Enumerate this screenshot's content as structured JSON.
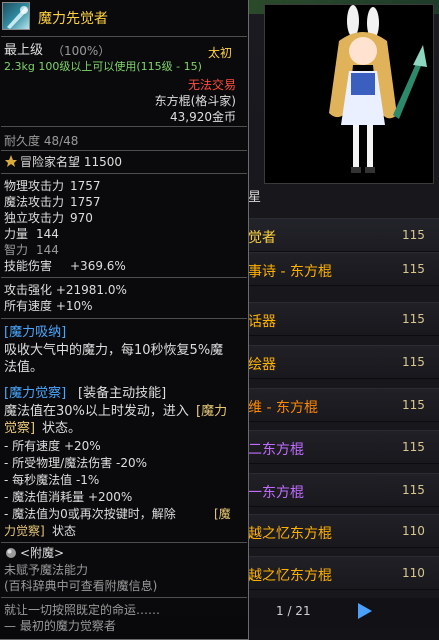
{
  "background": {
    "tab_label": "星",
    "items": [
      {
        "name": "觉者",
        "level": "115",
        "color": "#ffd23e"
      },
      {
        "name": "事诗 - 东方棍",
        "level": "115",
        "color": "#ffb100"
      },
      {
        "name": "话器",
        "level": "115",
        "color": "#ffb100"
      },
      {
        "name": "绘器",
        "level": "115",
        "color": "#ffb100"
      },
      {
        "name": "维 - 东方棍",
        "level": "115",
        "color": "#ff8800"
      },
      {
        "name": "二东方棍",
        "level": "115",
        "color": "#c26cff"
      },
      {
        "name": "一东方棍",
        "level": "115",
        "color": "#c26cff"
      },
      {
        "name": "越之忆东方棍",
        "level": "110",
        "color": "#ffb100"
      },
      {
        "name": "越之忆东方棍",
        "level": "110",
        "color": "#ffb100"
      }
    ],
    "page": "1 / 21"
  },
  "tooltip": {
    "title": "魔力先觉者",
    "grade": "最上级",
    "grade_pct": "（100%）",
    "rarity": "太初",
    "weight_req": "2.3kg  100级以上可以使用(115级 - 15)",
    "trade": "无法交易",
    "weapon_type": "东方棍(格斗家)",
    "price": "43,920金币",
    "durability": "耐久度 48/48",
    "adventurer": "冒险家名望 11500",
    "stats": [
      {
        "label": "物理攻击力",
        "value": "1757",
        "dim": false
      },
      {
        "label": "魔法攻击力",
        "value": "1757",
        "dim": false
      },
      {
        "label": "独立攻击力",
        "value": "970",
        "dim": false
      },
      {
        "label": "力量",
        "value": "144",
        "dim": false
      },
      {
        "label": "智力",
        "value": "144",
        "dim": true
      },
      {
        "label": "技能伤害",
        "value": "+369.6%",
        "dim": false
      }
    ],
    "attack_boost": "攻击强化 +21981.0%",
    "all_speed": "所有速度 +10%",
    "mana_absorb_title": "[魔力吸纳]",
    "mana_absorb_line1": "吸收大气中的魔力，每10秒恢复5%魔",
    "mana_absorb_line2": "法值。",
    "awaken_title": "[魔力觉察]",
    "awaken_tag": "[装备主动技能]",
    "awaken_line1a": "魔法值在30%以上时发动，进入",
    "awaken_line1b": "[魔力",
    "awaken_line2a": "觉察]",
    "awaken_line2b": "状态。",
    "awaken_effects": [
      "- 所有速度 +20%",
      "- 所受物理/魔法伤害 -20%",
      "- 每秒魔法值 -1%",
      "- 魔法值消耗量 +200%"
    ],
    "awaken_end1a": "- 魔法值为0或再次按键时，解除",
    "awaken_end1b": "[魔",
    "awaken_end2a": "力觉察]",
    "awaken_end2b": "状态",
    "enchant_title": "<附魔>",
    "enchant_none": "未赋予魔法能力",
    "enchant_hint": "(百科辞典中可查看附魔信息)",
    "flavor1": "就让一切按照既定的命运……",
    "flavor2": "— 最初的魔力觉察者"
  }
}
